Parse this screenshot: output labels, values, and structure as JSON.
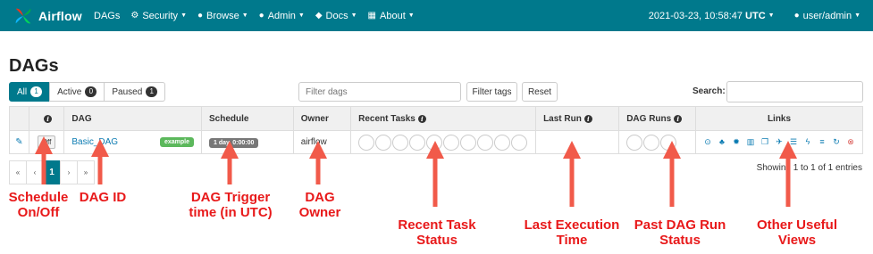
{
  "navbar": {
    "brand": "Airflow",
    "items": [
      {
        "label": "DAGs",
        "icon": "",
        "caret": false
      },
      {
        "label": "Security",
        "icon": "gear-icon",
        "caret": true
      },
      {
        "label": "Browse",
        "icon": "globe-icon",
        "caret": true
      },
      {
        "label": "Admin",
        "icon": "user-icon",
        "caret": true
      },
      {
        "label": "Docs",
        "icon": "cube-icon",
        "caret": true
      },
      {
        "label": "About",
        "icon": "grid-icon",
        "caret": true
      }
    ],
    "datetime": "2021-03-23, 10:58:47",
    "timezone": "UTC",
    "user": "user/admin"
  },
  "page": {
    "title": "DAGs"
  },
  "tabs": [
    {
      "label": "All",
      "count": "1"
    },
    {
      "label": "Active",
      "count": "0"
    },
    {
      "label": "Paused",
      "count": "1"
    }
  ],
  "filter": {
    "placeholder": "Filter dags",
    "filter_tags_label": "Filter tags",
    "reset_label": "Reset"
  },
  "search": {
    "label": "Search:"
  },
  "table": {
    "headers": [
      "DAG",
      "Schedule",
      "Owner",
      "Recent Tasks",
      "Last Run",
      "DAG Runs",
      "Links"
    ],
    "rows": [
      {
        "toggle": "Off",
        "dag_id": "Basic_DAG",
        "tag": "example",
        "schedule": "1 day, 0:00:00",
        "owner": "airflow",
        "last_run": ""
      }
    ]
  },
  "pagination": {
    "first": "«",
    "prev": "‹",
    "current": "1",
    "next": "›",
    "last": "»",
    "showing": "Showing 1 to 1 of 1 entries"
  },
  "annotations": [
    {
      "line1": "Schedule",
      "line2": "On/Off"
    },
    {
      "line1": "DAG ID",
      "line2": ""
    },
    {
      "line1": "DAG Trigger",
      "line2": "time (in UTC)"
    },
    {
      "line1": "DAG Owner",
      "line2": ""
    },
    {
      "line1": "Recent Task",
      "line2": "Status"
    },
    {
      "line1": "Last Execution",
      "line2": "Time"
    },
    {
      "line1": "Past DAG Run",
      "line2": "Status"
    },
    {
      "line1": "Other Useful",
      "line2": "Views"
    }
  ],
  "colors": {
    "navbar": "#00798c",
    "annotation": "#e8191a",
    "link": "#0b7bb2",
    "tag_green": "#5cb85c"
  }
}
